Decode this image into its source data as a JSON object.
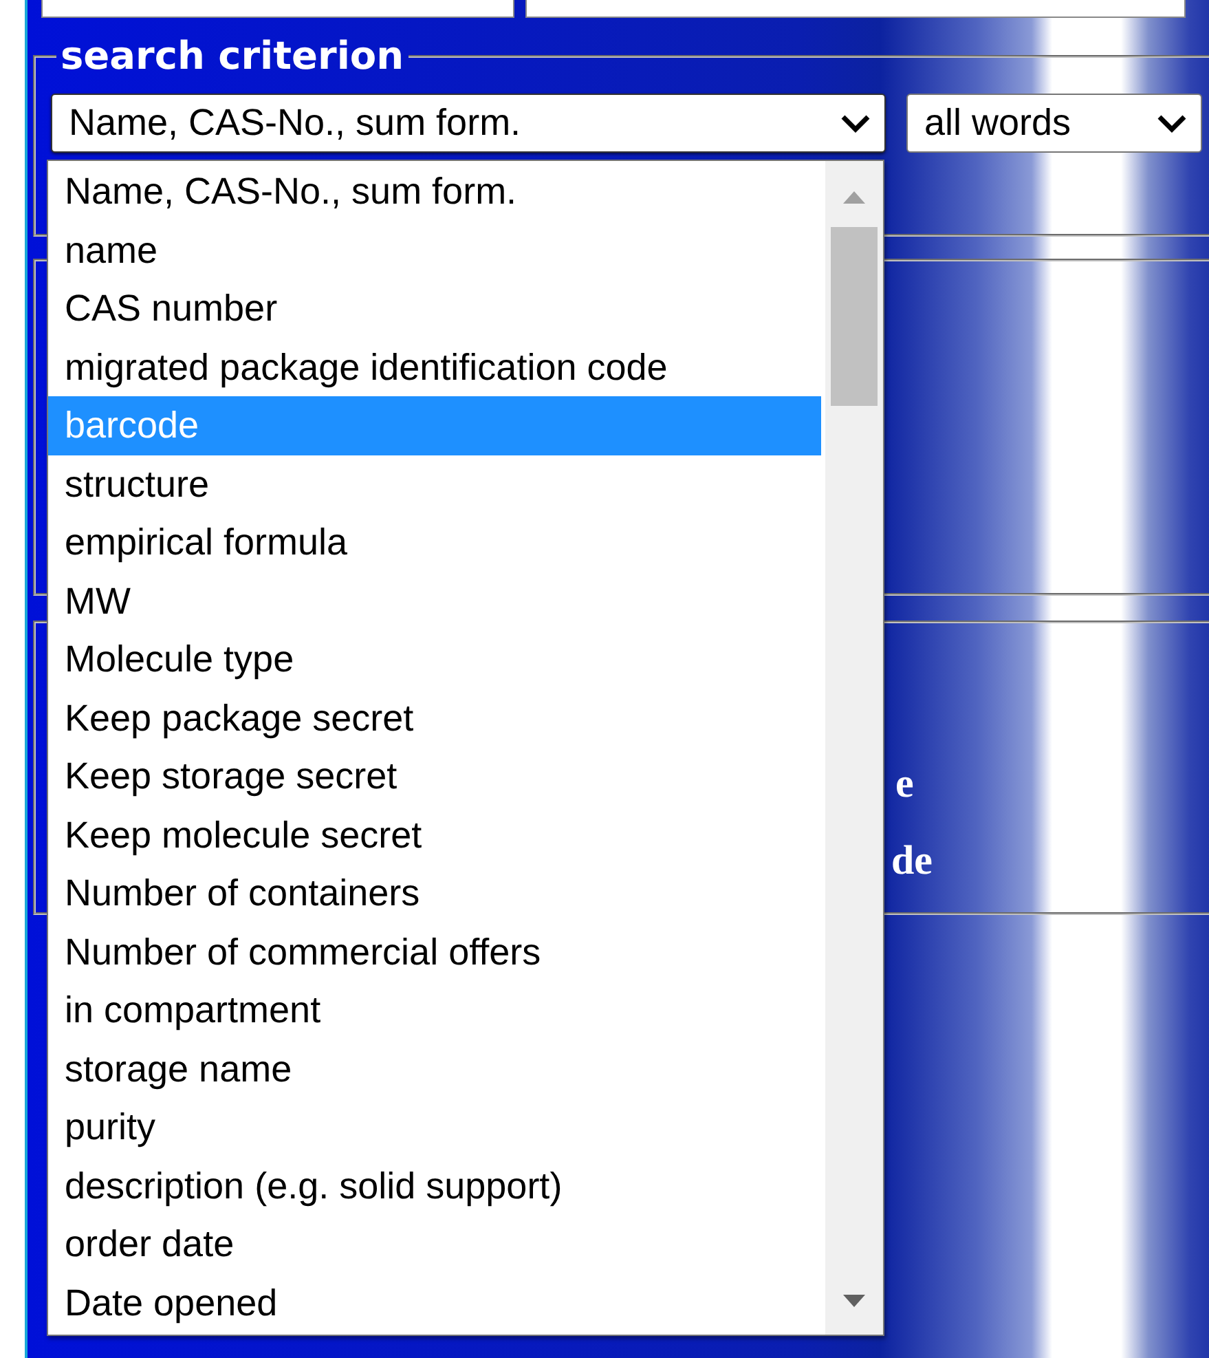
{
  "fieldset": {
    "legend": "search criterion"
  },
  "criterion_select": {
    "value": "Name, CAS-No., sum form.",
    "expanded": true
  },
  "mode_select": {
    "value": "all words"
  },
  "dropdown": {
    "options": [
      {
        "label": "Name, CAS-No., sum form.",
        "selected": false
      },
      {
        "label": "name",
        "selected": false
      },
      {
        "label": "CAS number",
        "selected": false
      },
      {
        "label": "migrated package identification code",
        "selected": false
      },
      {
        "label": "barcode",
        "selected": true
      },
      {
        "label": "structure",
        "selected": false
      },
      {
        "label": "empirical formula",
        "selected": false
      },
      {
        "label": "MW",
        "selected": false
      },
      {
        "label": "Molecule type",
        "selected": false
      },
      {
        "label": "Keep package secret",
        "selected": false
      },
      {
        "label": "Keep storage secret",
        "selected": false
      },
      {
        "label": "Keep molecule secret",
        "selected": false
      },
      {
        "label": "Number of containers",
        "selected": false
      },
      {
        "label": "Number of commercial offers",
        "selected": false
      },
      {
        "label": "in compartment",
        "selected": false
      },
      {
        "label": "storage name",
        "selected": false
      },
      {
        "label": "purity",
        "selected": false
      },
      {
        "label": "description (e.g. solid support)",
        "selected": false
      },
      {
        "label": "order date",
        "selected": false
      },
      {
        "label": "Date opened",
        "selected": false
      }
    ]
  },
  "covered_labels": [
    "e",
    "de"
  ]
}
